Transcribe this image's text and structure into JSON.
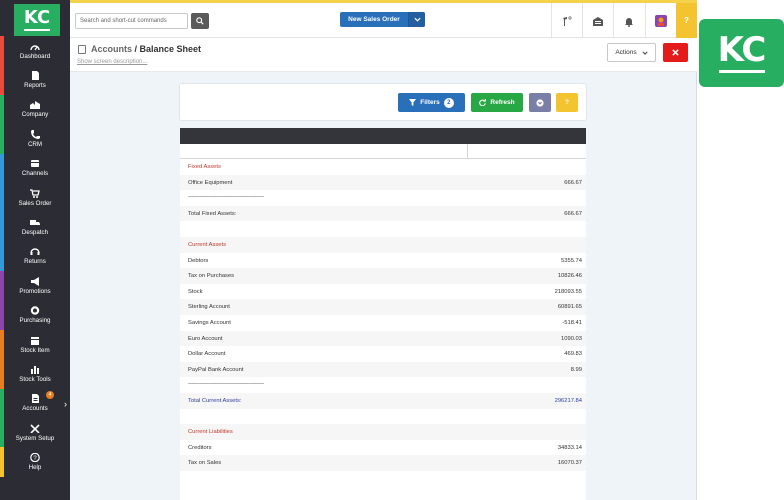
{
  "brand": {
    "logo_text": "KC",
    "accent": "#27ae60"
  },
  "topbar": {
    "search_placeholder": "Search and short-cut commands",
    "new_sales_order": "New Sales Order",
    "help": "?"
  },
  "sidebar": {
    "items": [
      {
        "label": "Dashboard",
        "icon": "dashboard-icon",
        "stripe": "#e74c3c"
      },
      {
        "label": "Reports",
        "icon": "document-icon",
        "stripe": "#e74c3c"
      },
      {
        "label": "Company",
        "icon": "company-icon",
        "stripe": "#27ae60"
      },
      {
        "label": "CRM",
        "icon": "phone-icon",
        "stripe": "#27ae60"
      },
      {
        "label": "Channels",
        "icon": "channels-icon",
        "stripe": "#3498db"
      },
      {
        "label": "Sales Order",
        "icon": "cart-icon",
        "stripe": "#3498db"
      },
      {
        "label": "Despatch",
        "icon": "truck-icon",
        "stripe": "#3498db"
      },
      {
        "label": "Returns",
        "icon": "headset-icon",
        "stripe": "#3498db"
      },
      {
        "label": "Promotions",
        "icon": "megaphone-icon",
        "stripe": "#8e44ad"
      },
      {
        "label": "Purchasing",
        "icon": "coin-icon",
        "stripe": "#8e44ad"
      },
      {
        "label": "Stock Item",
        "icon": "box-icon",
        "stripe": "#e67e22"
      },
      {
        "label": "Stock Tools",
        "icon": "bar-chart-icon",
        "stripe": "#e67e22"
      },
      {
        "label": "Accounts",
        "icon": "accounts-icon",
        "stripe": "#27ae60",
        "badge": "4"
      },
      {
        "label": "System Setup",
        "icon": "tools-icon",
        "stripe": "#27ae60"
      },
      {
        "label": "Help",
        "icon": "help-circle-icon",
        "stripe": "#f4c430"
      }
    ]
  },
  "header": {
    "crumb_parent": "Accounts",
    "crumb_sep": " / ",
    "crumb_current": "Balance Sheet",
    "screen_description": "Show screen description...",
    "actions": "Actions"
  },
  "toolbar": {
    "filters": "Filters",
    "filters_count": "2",
    "refresh": "Refresh",
    "help": "?"
  },
  "report": {
    "rows": [
      {
        "type": "section",
        "label": "Fixed Assets",
        "value": ""
      },
      {
        "type": "item",
        "label": "Office Equipment",
        "value": "666.67"
      },
      {
        "type": "sep",
        "label": "-----------------------------------------------------",
        "value": ""
      },
      {
        "type": "item",
        "label": "Total Fixed Assets:",
        "value": "666.67"
      },
      {
        "type": "blank",
        "label": "",
        "value": ""
      },
      {
        "type": "section",
        "label": "Current Assets",
        "value": ""
      },
      {
        "type": "item",
        "label": "Debtors",
        "value": "5355.74"
      },
      {
        "type": "item",
        "label": "Tax on Purchases",
        "value": "10826.46"
      },
      {
        "type": "item",
        "label": "Stock",
        "value": "218093.55"
      },
      {
        "type": "item",
        "label": "Sterling Account",
        "value": "60891.65"
      },
      {
        "type": "item",
        "label": "Savings Account",
        "value": "-518.41"
      },
      {
        "type": "item",
        "label": "Euro Account",
        "value": "1090.03"
      },
      {
        "type": "item",
        "label": "Dollar Account",
        "value": "469.83"
      },
      {
        "type": "item",
        "label": "PayPal Bank Account",
        "value": "8.99"
      },
      {
        "type": "sep",
        "label": "-----------------------------------------------------",
        "value": ""
      },
      {
        "type": "total-blue",
        "label": "Total Current Assets:",
        "value": "296217.84"
      },
      {
        "type": "blank",
        "label": "",
        "value": ""
      },
      {
        "type": "section",
        "label": "Current Liabilities",
        "value": ""
      },
      {
        "type": "item",
        "label": "Creditors",
        "value": "34833.14"
      },
      {
        "type": "item",
        "label": "Tax on Sales",
        "value": "16070.37"
      }
    ]
  }
}
